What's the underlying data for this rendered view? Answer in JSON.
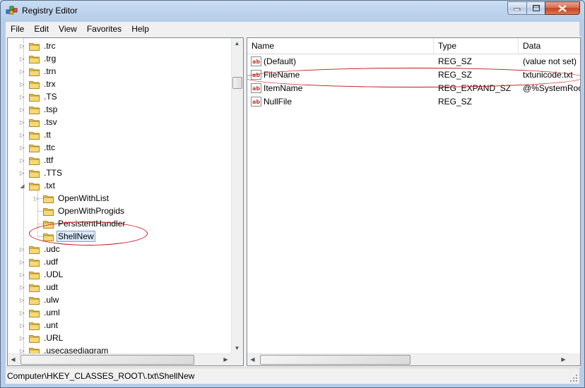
{
  "window": {
    "title": "Registry Editor"
  },
  "menu": [
    "File",
    "Edit",
    "View",
    "Favorites",
    "Help"
  ],
  "tree": {
    "items": [
      {
        "label": ".trc",
        "level": 1,
        "expander": "collapsed"
      },
      {
        "label": ".trg",
        "level": 1,
        "expander": "collapsed"
      },
      {
        "label": ".trn",
        "level": 1,
        "expander": "collapsed"
      },
      {
        "label": ".trx",
        "level": 1,
        "expander": "collapsed"
      },
      {
        "label": ".TS",
        "level": 1,
        "expander": "collapsed"
      },
      {
        "label": ".tsp",
        "level": 1,
        "expander": "collapsed"
      },
      {
        "label": ".tsv",
        "level": 1,
        "expander": "collapsed"
      },
      {
        "label": ".tt",
        "level": 1,
        "expander": "collapsed"
      },
      {
        "label": ".ttc",
        "level": 1,
        "expander": "collapsed"
      },
      {
        "label": ".ttf",
        "level": 1,
        "expander": "collapsed"
      },
      {
        "label": ".TTS",
        "level": 1,
        "expander": "collapsed"
      },
      {
        "label": ".txt",
        "level": 1,
        "expander": "expanded"
      },
      {
        "label": "OpenWithList",
        "level": 2,
        "expander": "collapsed"
      },
      {
        "label": "OpenWithProgids",
        "level": 2,
        "expander": "none"
      },
      {
        "label": "PersistentHandler",
        "level": 2,
        "expander": "none"
      },
      {
        "label": "ShellNew",
        "level": 2,
        "expander": "none",
        "selected": true
      },
      {
        "label": ".udc",
        "level": 1,
        "expander": "collapsed"
      },
      {
        "label": ".udf",
        "level": 1,
        "expander": "collapsed"
      },
      {
        "label": ".UDL",
        "level": 1,
        "expander": "collapsed"
      },
      {
        "label": ".udt",
        "level": 1,
        "expander": "collapsed"
      },
      {
        "label": ".ulw",
        "level": 1,
        "expander": "collapsed"
      },
      {
        "label": ".uml",
        "level": 1,
        "expander": "collapsed"
      },
      {
        "label": ".unt",
        "level": 1,
        "expander": "collapsed"
      },
      {
        "label": ".URL",
        "level": 1,
        "expander": "collapsed"
      },
      {
        "label": ".usecasediagram",
        "level": 1,
        "expander": "collapsed"
      }
    ]
  },
  "list": {
    "columns": [
      "Name",
      "Type",
      "Data"
    ],
    "rows": [
      {
        "name": "(Default)",
        "type": "REG_SZ",
        "data": "(value not set)"
      },
      {
        "name": "FileName",
        "type": "REG_SZ",
        "data": "txtunicode.txt"
      },
      {
        "name": "ItemName",
        "type": "REG_EXPAND_SZ",
        "data": "@%SystemRoot%"
      },
      {
        "name": "NullFile",
        "type": "REG_SZ",
        "data": ""
      }
    ]
  },
  "status": {
    "path": "Computer\\HKEY_CLASSES_ROOT\\.txt\\ShellNew"
  },
  "icons": {
    "folder": "folder-icon",
    "value": "string-value-icon"
  },
  "colors": {
    "annotation": "#c0151a",
    "selection": "#dceafc"
  }
}
